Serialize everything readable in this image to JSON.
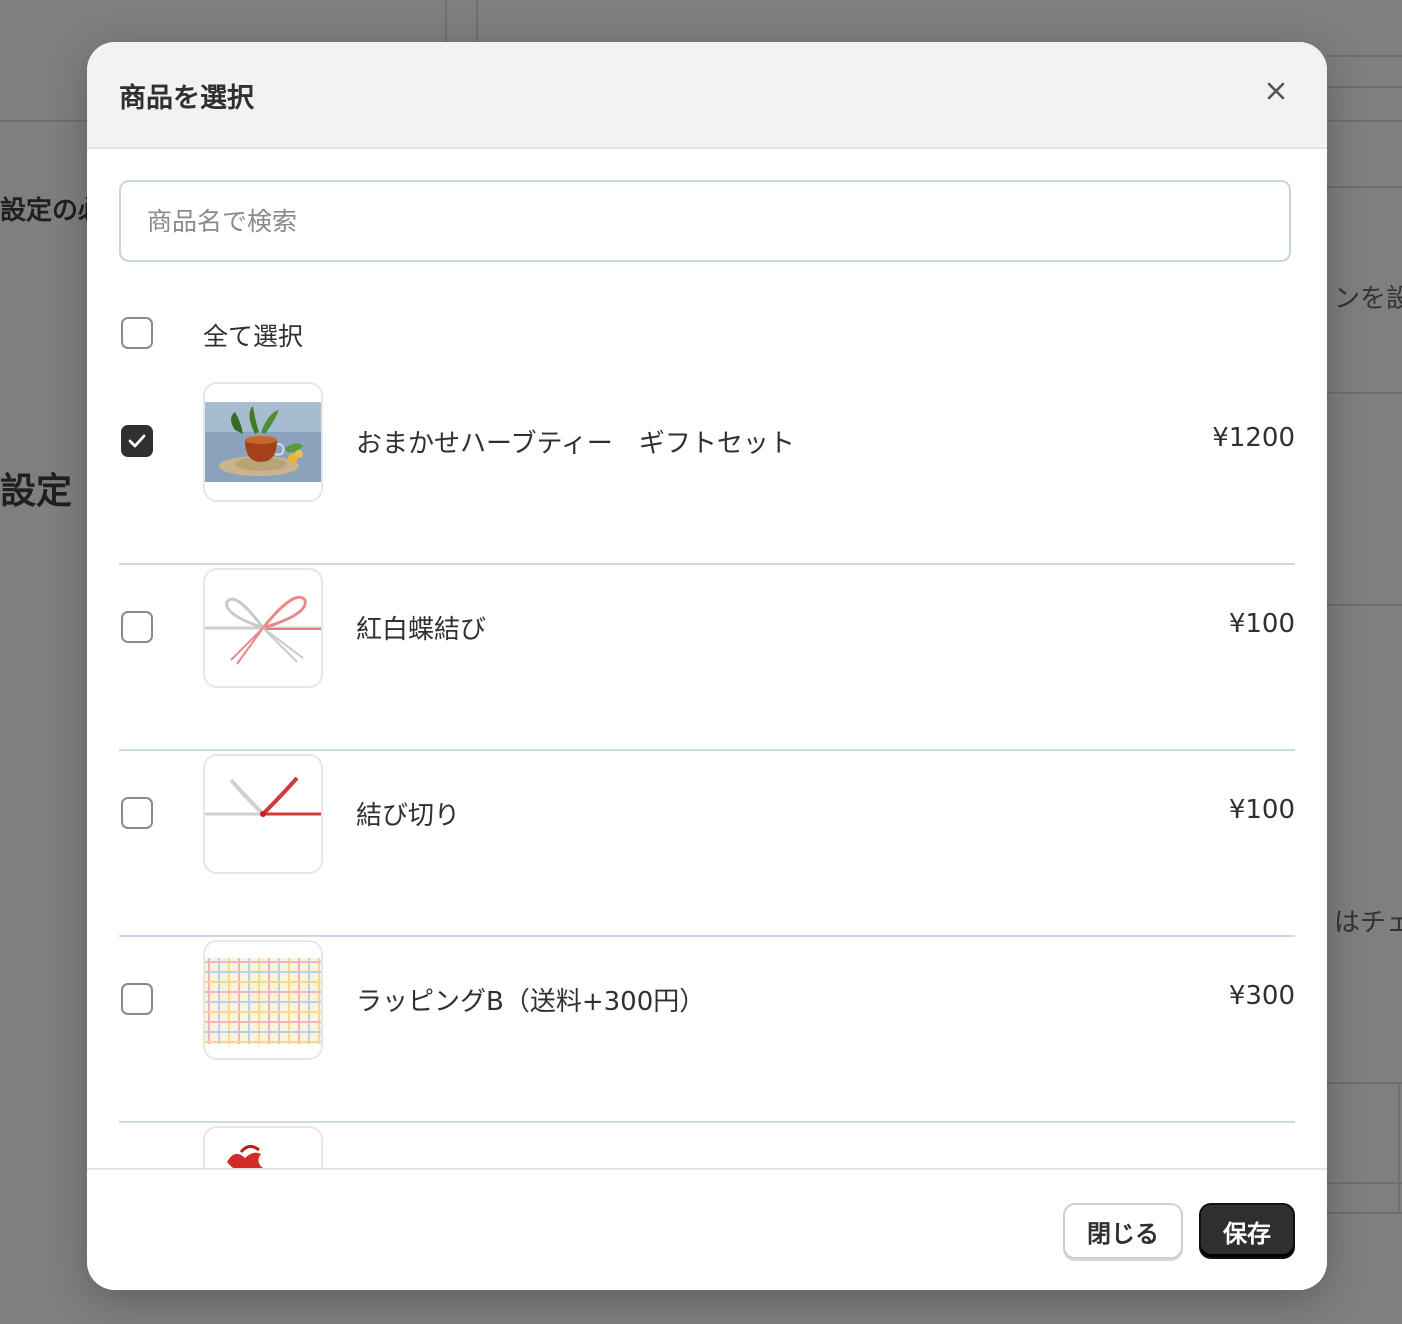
{
  "background": {
    "texts": [
      "設定の必",
      "設定",
      "ンを設",
      "はチェ"
    ]
  },
  "modal": {
    "title": "商品を選択",
    "close_icon": "close-icon",
    "search": {
      "placeholder": "商品名で検索",
      "value": ""
    },
    "select_all": {
      "label": "全て選択",
      "checked": false
    },
    "products": [
      {
        "name": "おまかせハーブティー　ギフトセット",
        "price": "¥1200",
        "checked": true,
        "image": "herb-tea-image"
      },
      {
        "name": "紅白蝶結び",
        "price": "¥100",
        "checked": false,
        "image": "bow-knot-image"
      },
      {
        "name": "結び切り",
        "price": "¥100",
        "checked": false,
        "image": "tied-knot-image"
      },
      {
        "name": "ラッピングB（送料+300円）",
        "price": "¥300",
        "checked": false,
        "image": "plaid-wrapping-image"
      },
      {
        "name": "",
        "price": "",
        "checked": false,
        "image": "red-ribbon-image"
      }
    ],
    "footer": {
      "close_label": "閉じる",
      "save_label": "保存"
    }
  },
  "colors": {
    "accent": "#303030",
    "overlay": "#7f7f7f",
    "divider": "#c9d9ea"
  }
}
